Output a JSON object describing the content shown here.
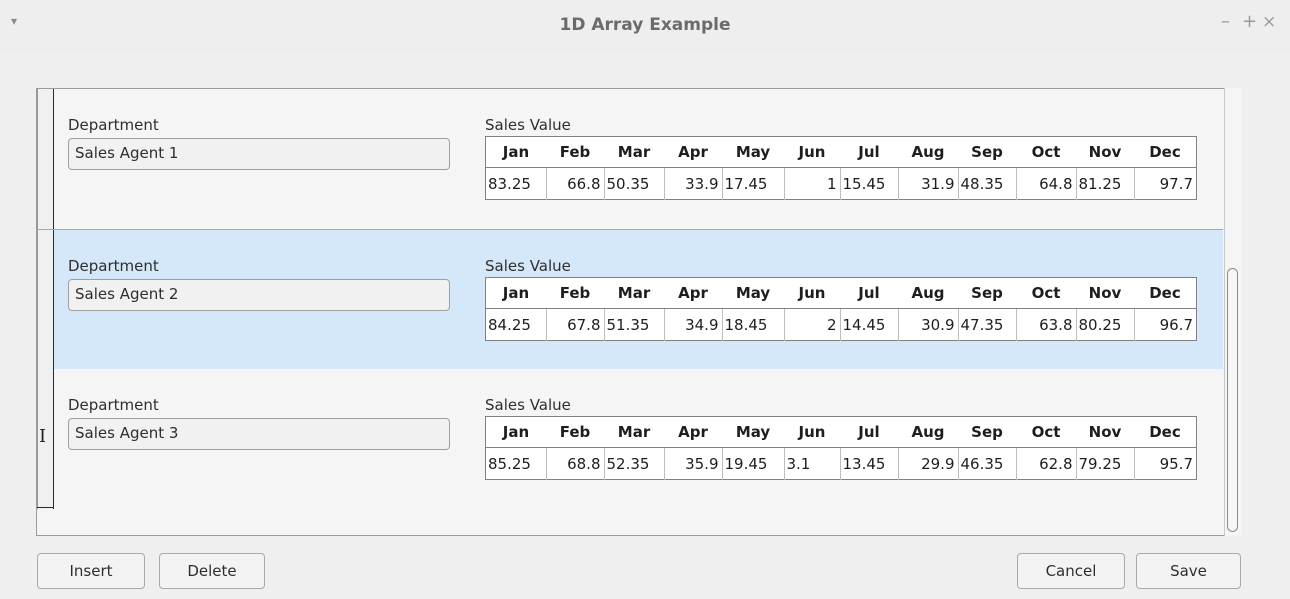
{
  "window": {
    "title": "1D Array Example",
    "menu_icon": "▾",
    "min": "–",
    "max": "+",
    "close": "×"
  },
  "months": [
    "Jan",
    "Feb",
    "Mar",
    "Apr",
    "May",
    "Jun",
    "Jul",
    "Aug",
    "Sep",
    "Oct",
    "Nov",
    "Dec"
  ],
  "rows": [
    {
      "dept_label": "Department",
      "dept_value": "Sales Agent 1",
      "sales_label": "Sales Value",
      "values": [
        "83.25",
        "66.8",
        "50.35",
        "33.9",
        "17.45",
        "1",
        "15.45",
        "31.9",
        "48.35",
        "64.8",
        "81.25",
        "97.7"
      ]
    },
    {
      "dept_label": "Department",
      "dept_value": "Sales Agent 2",
      "sales_label": "Sales Value",
      "values": [
        "84.25",
        "67.8",
        "51.35",
        "34.9",
        "18.45",
        "2",
        "14.45",
        "30.9",
        "47.35",
        "63.8",
        "80.25",
        "96.7"
      ]
    },
    {
      "dept_label": "Department",
      "dept_value": "Sales Agent 3",
      "sales_label": "Sales Value",
      "values": [
        "85.25",
        "68.8",
        "52.35",
        "35.9",
        "19.45",
        "3.1",
        "13.45",
        "29.9",
        "46.35",
        "62.8",
        "79.25",
        "95.7"
      ]
    }
  ],
  "buttons": {
    "insert": "Insert",
    "delete": "Delete",
    "cancel": "Cancel",
    "save": "Save"
  },
  "cursor_glyph": "I",
  "colors": {
    "selected_row": "#d5e8fa",
    "background": "#efefef"
  }
}
